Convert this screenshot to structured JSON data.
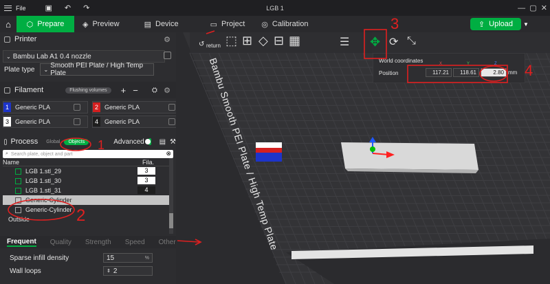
{
  "window": {
    "title": "LGB 1",
    "file_menu": "File"
  },
  "nav": {
    "tabs": [
      {
        "label": "Prepare"
      },
      {
        "label": "Preview"
      },
      {
        "label": "Device"
      },
      {
        "label": "Project"
      },
      {
        "label": "Calibration"
      }
    ],
    "upload_label": "Upload"
  },
  "printer": {
    "header": "Printer",
    "name": "Bambu Lab A1 0.4 nozzle",
    "plate_type_label": "Plate type",
    "plate_type_value": "Smooth PEI Plate / High Temp Plate"
  },
  "filament": {
    "header": "Filament",
    "flushing_label": "Flushing volumes",
    "slots": [
      {
        "num": "1",
        "name": "Generic PLA",
        "color": "#1d34c9"
      },
      {
        "num": "2",
        "name": "Generic PLA",
        "color": "#d32020"
      },
      {
        "num": "3",
        "name": "Generic PLA",
        "color": "#ffffff"
      },
      {
        "num": "4",
        "name": "Generic PLA",
        "color": "#1e1e1e"
      }
    ]
  },
  "process": {
    "header": "Process",
    "global_label": "Global",
    "objects_label": "Objects",
    "advanced_label": "Advanced",
    "search_placeholder": "Search plate, object and part",
    "col_name": "Name",
    "col_fila": "Fila.",
    "rows": [
      {
        "name": "LGB 1.stl_29",
        "fila": "3"
      },
      {
        "name": "LGB 1.stl_30",
        "fila": "3"
      },
      {
        "name": "LGB 1.stl_31",
        "fila": "4"
      },
      {
        "name": "Generic-Cylinder",
        "fila": ""
      },
      {
        "name": "Generic-Cylinder",
        "fila": ""
      }
    ],
    "outside_label": "Outside"
  },
  "settings_tabs": [
    "Frequent",
    "Quality",
    "Strength",
    "Speed",
    "Others"
  ],
  "settings": {
    "sparse_label": "Sparse infill density",
    "sparse_value": "15",
    "sparse_unit": "%",
    "walls_label": "Wall loops",
    "walls_value": "2"
  },
  "viewport": {
    "return_label": "return",
    "plate_text": "Bambu Smooth PEI Plate / High Temp Plate",
    "world_coords_label": "World coordinates",
    "position_label": "Position",
    "axis_x": "X",
    "axis_y": "Y",
    "axis_z": "Z",
    "pos_x": "117.21",
    "pos_y": "118.61",
    "pos_z": "2.80",
    "unit": "mm"
  },
  "annotations": {
    "n1": "1",
    "n2": "2",
    "n3": "3",
    "n4": "4"
  },
  "colors": {
    "accent": "#00ae42",
    "annotation": "#e02020"
  }
}
